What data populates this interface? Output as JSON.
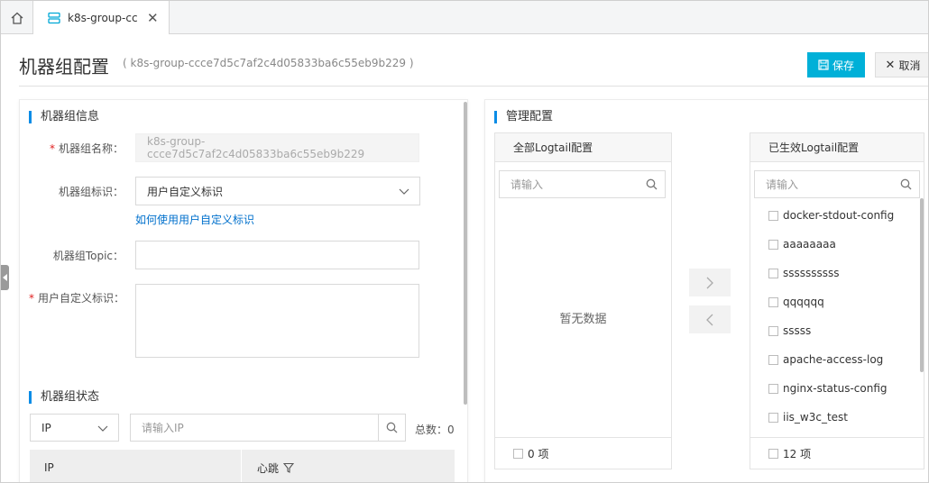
{
  "tabs": [
    {
      "label": "k8s-group-cc"
    }
  ],
  "header": {
    "title": "机器组配置",
    "subtitle": "( k8s-group-ccce7d5c7af2c4d05833ba6c55eb9b229 )",
    "save_label": "保存",
    "cancel_label": "取消"
  },
  "group_info": {
    "section_title": "机器组信息",
    "name_label": "机器组名称：",
    "name_value": "k8s-group-ccce7d5c7af2c4d05833ba6c55eb9b229",
    "identity_label": "机器组标识：",
    "identity_value": "用户自定义标识",
    "help_link": "如何使用用户自定义标识",
    "topic_label": "机器组Topic：",
    "topic_value": "",
    "custom_label": "用户自定义标识：",
    "custom_value": ""
  },
  "group_status": {
    "section_title": "机器组状态",
    "filter_value": "IP",
    "search_placeholder": "请输入IP",
    "total_label": "总数：0",
    "col_ip": "IP",
    "col_heartbeat": "心跳"
  },
  "manage": {
    "section_title": "管理配置",
    "all": {
      "header": "全部Logtail配置",
      "search_placeholder": "请输入",
      "empty_text": "暂无数据",
      "footer": "0 项"
    },
    "active": {
      "header": "已生效Logtail配置",
      "search_placeholder": "请输入",
      "items": [
        "docker-stdout-config",
        "aaaaaaaa",
        "ssssssssss",
        "qqqqqq",
        "sssss",
        "apache-access-log",
        "nginx-status-config",
        "iis_w3c_test"
      ],
      "footer": "12 项"
    }
  },
  "colors": {
    "accent": "#00b0d8",
    "link": "#0070cc",
    "section_bar": "#0a8ce6",
    "required": "#e02020"
  }
}
